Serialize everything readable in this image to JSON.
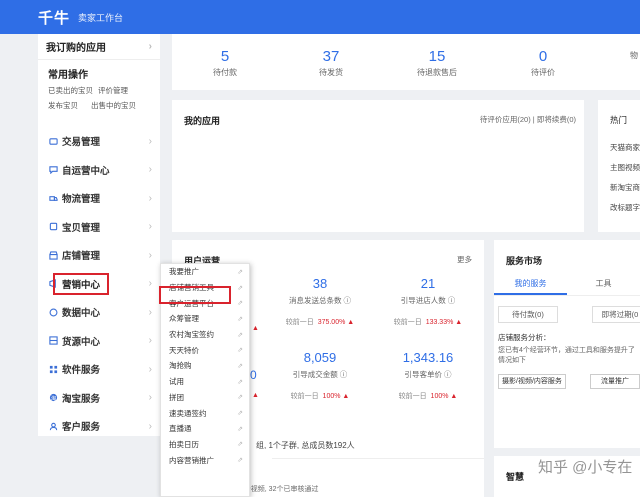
{
  "header": {
    "logo": "千牛",
    "subtitle": "卖家工作台",
    "accent": "#2f6ee6"
  },
  "sidebar": {
    "head": "我订购的应用",
    "common_title": "常用操作",
    "common_links": [
      "已卖出的宝贝",
      "评价管理",
      "发布宝贝",
      "出售中的宝贝"
    ],
    "items": [
      {
        "label": "交易管理",
        "icon": "trade-icon"
      },
      {
        "label": "自运营中心",
        "icon": "chat-icon"
      },
      {
        "label": "物流管理",
        "icon": "truck-icon"
      },
      {
        "label": "宝贝管理",
        "icon": "box-icon"
      },
      {
        "label": "店铺管理",
        "icon": "shop-icon"
      },
      {
        "label": "营销中心",
        "icon": "marketing-icon"
      },
      {
        "label": "数据中心",
        "icon": "data-icon"
      },
      {
        "label": "货源中心",
        "icon": "source-icon"
      },
      {
        "label": "软件服务",
        "icon": "grid-icon"
      },
      {
        "label": "淘宝服务",
        "icon": "taobao-icon"
      },
      {
        "label": "客户服务",
        "icon": "customer-icon"
      }
    ]
  },
  "stats": [
    {
      "value": "5",
      "label": "待付款"
    },
    {
      "value": "37",
      "label": "待发货"
    },
    {
      "value": "15",
      "label": "待退款售后"
    },
    {
      "value": "0",
      "label": "待评价"
    },
    {
      "value": "",
      "label": "物"
    }
  ],
  "apps": {
    "title": "我的应用",
    "right": "待评价应用(20) | 即将续费(0)"
  },
  "hot": {
    "title": "热门",
    "items": [
      "天猫商家",
      "主图视频",
      "新淘宝商",
      "改标题字"
    ]
  },
  "ops": {
    "title": "用户运营",
    "more": "更多",
    "metrics": [
      {
        "value": "38",
        "label": "消息发送总条数 ⓘ",
        "cmp": "较前一日",
        "pct": "375.00% ▲"
      },
      {
        "value": "21",
        "label": "引导进店人数 ⓘ",
        "cmp": "较前一日",
        "pct": "133.33% ▲"
      },
      {
        "value": "8,059",
        "label": "引导成交金额 ⓘ",
        "cmp": "较前一日",
        "pct": "100% ▲"
      },
      {
        "value": "1,343.16",
        "label": "引导客单价 ⓘ",
        "cmp": "较前一日",
        "pct": "100% ▲"
      }
    ],
    "left_clip": [
      "▲",
      "0",
      "▲"
    ],
    "line": "组, 1个子群, 总成员数192人",
    "bottom": "共有32个视频, 32个已审核通过"
  },
  "market": {
    "title": "服务市场",
    "tabs": [
      "我的服务",
      "工具"
    ],
    "buttons": [
      "待付款(0)",
      "即将过期(0"
    ],
    "analysis": "店铺服务分析：",
    "text": "您已有4个经营环节，通过工具和服务提升了情况如下",
    "tags": [
      "摄影/视频/内容服务",
      "流量推广"
    ]
  },
  "smart": {
    "title": "智慧"
  },
  "flyout": {
    "items": [
      "我要推广",
      "店铺营销工具",
      "客户运营平台",
      "众筹管理",
      "农村淘宝签约",
      "天天特价",
      "淘抢购",
      "试用",
      "拼团",
      "速卖通签约",
      "直播通",
      "拍卖日历",
      "内容营销推广"
    ]
  },
  "watermark": "知乎 @小专在"
}
